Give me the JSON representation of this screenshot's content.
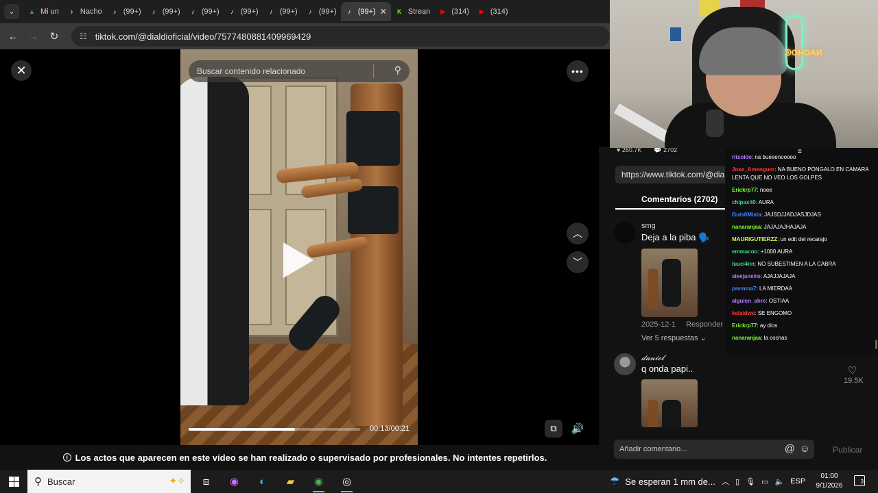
{
  "browser": {
    "tabs": [
      {
        "label": "Mi un",
        "icon": "drive-icon",
        "color": "#34a853"
      },
      {
        "label": "Nacho",
        "icon": "tiktok-icon",
        "color": "#ffffff"
      },
      {
        "label": "(99+)",
        "icon": "tiktok-icon",
        "color": "#ffffff"
      },
      {
        "label": "(99+)",
        "icon": "tiktok-icon",
        "color": "#ffffff"
      },
      {
        "label": "(99+)",
        "icon": "tiktok-icon",
        "color": "#ffffff"
      },
      {
        "label": "(99+)",
        "icon": "tiktok-icon",
        "color": "#ffffff"
      },
      {
        "label": "(99+)",
        "icon": "tiktok-icon",
        "color": "#ffffff"
      },
      {
        "label": "(99+)",
        "icon": "tiktok-icon",
        "color": "#ffffff"
      },
      {
        "label": "(99+)",
        "icon": "tiktok-icon",
        "color": "#ffffff"
      },
      {
        "label": "Strean",
        "icon": "kick-icon",
        "color": "#53fc18"
      },
      {
        "label": "(314)",
        "icon": "youtube-icon",
        "color": "#ff0000"
      },
      {
        "label": "(314)",
        "icon": "youtube-icon",
        "color": "#ff0000"
      }
    ],
    "url": "tiktok.com/@dialdioficial/video/7577480881409969429"
  },
  "video": {
    "search_placeholder": "Buscar contenido relacionado",
    "time": "00:13/00:21",
    "progress": 0.62
  },
  "disclaimer": "Los actos que aparecen en este vídeo se han realizado o supervisado por profesionales. No intentes repetirlos.",
  "panel": {
    "stats": [
      "260.7K",
      "2702"
    ],
    "link": "https://www.tiktok.com/@dialdi",
    "comments_tab": "Comentarios (2702)",
    "comments": [
      {
        "user": "smg",
        "text": "Deja a la piba 🗣️",
        "date": "2025-12-1",
        "reply": "Responder",
        "more": "Ver 5 respuestas ⌄"
      },
      {
        "user": "𝓭𝓪𝓷𝓲𝓮𝓵",
        "text": "q onda papi..",
        "likes": "19.5K"
      }
    ],
    "input_placeholder": "Añadir comentario...",
    "publish": "Publicar"
  },
  "stream": {
    "neon_text": "ᕲOHOAИ"
  },
  "chat": [
    {
      "user": "ritsoide",
      "color": "#b77bff",
      "text": "na bueeenooooo"
    },
    {
      "user": "Jose_Amenguer",
      "color": "#ff3b30",
      "text": "NA BUENO PÓNGALO EN CAMARA LENTA QUE NO VEO LOS GOLPES"
    },
    {
      "user": "Erickrp77",
      "color": "#7cfc3a",
      "text": "noee"
    },
    {
      "user": "chipaxit0",
      "color": "#3ddc84",
      "text": "AURA"
    },
    {
      "user": "Guis0Mista",
      "color": "#3d8bff",
      "text": "JAJSDJJADJASJDJAS"
    },
    {
      "user": "nanaranjaa",
      "color": "#7cfc3a",
      "text": "JAJAJAJHAJAJA"
    },
    {
      "user": "MAURIGUTIERZZ",
      "color": "#c6ff3a",
      "text": "un edit del recarajo"
    },
    {
      "user": "emmacoo",
      "color": "#3ddc84",
      "text": "+1000 AURA"
    },
    {
      "user": "luuci4nn",
      "color": "#3ddc84",
      "text": "NO SUBESTIMEN A LA CABRA"
    },
    {
      "user": "aleejaneiro",
      "color": "#b77bff",
      "text": "AJAJJAJAJA"
    },
    {
      "user": "premma7",
      "color": "#3d8bff",
      "text": "LA MIERDAA"
    },
    {
      "user": "alguien_ahre",
      "color": "#b77bff",
      "text": "OSTIAA"
    },
    {
      "user": "kelaldwe",
      "color": "#ff3b30",
      "text": "SE ENGOMO"
    },
    {
      "user": "Erickrp77",
      "color": "#7cfc3a",
      "text": "ay dios"
    },
    {
      "user": "nanaranjaa",
      "color": "#7cfc3a",
      "text": "la cochas"
    }
  ],
  "taskbar": {
    "search": "Buscar",
    "weather": "Se esperan 1 mm de...",
    "lang": "ESP",
    "time": "01:00",
    "date": "9/1/2026",
    "notif_count": "3"
  }
}
